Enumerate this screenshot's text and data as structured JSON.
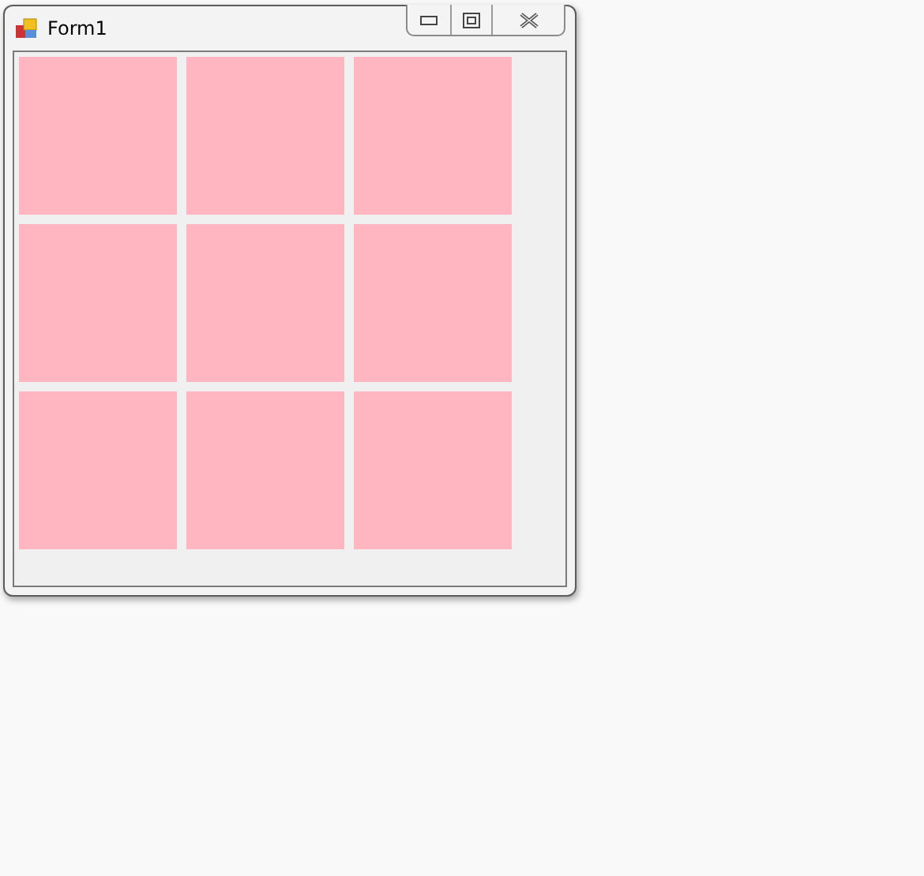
{
  "window": {
    "title": "Form1"
  },
  "tiles": [
    {
      "color": "#ffb6c1"
    },
    {
      "color": "#ffb6c1"
    },
    {
      "color": "#ffb6c1"
    },
    {
      "color": "#ffb6c1"
    },
    {
      "color": "#ffb6c1"
    },
    {
      "color": "#ffb6c1"
    },
    {
      "color": "#ffb6c1"
    },
    {
      "color": "#ffb6c1"
    },
    {
      "color": "#ffb6c1"
    }
  ]
}
